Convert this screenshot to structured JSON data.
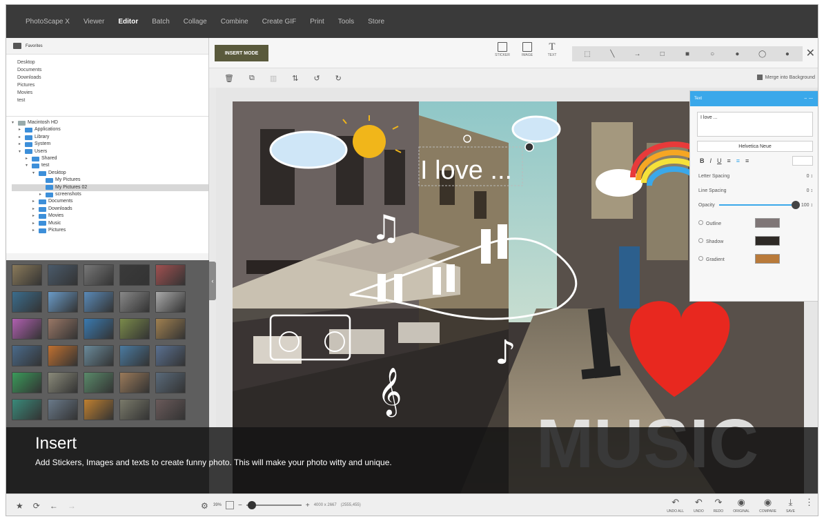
{
  "nav": {
    "items": [
      "PhotoScape X",
      "Viewer",
      "Editor",
      "Batch",
      "Collage",
      "Combine",
      "Create GIF",
      "Print",
      "Tools",
      "Store"
    ],
    "active": "Editor"
  },
  "sidebar": {
    "favorites_title": "Favorites",
    "favorites": [
      "Desktop",
      "Documents",
      "Downloads",
      "Pictures",
      "Movies",
      "test"
    ],
    "tree": [
      {
        "label": "Macintosh HD",
        "depth": 0,
        "type": "hd",
        "arrow": "▾"
      },
      {
        "label": "Applications",
        "depth": 1,
        "type": "folder",
        "arrow": "▸"
      },
      {
        "label": "Library",
        "depth": 1,
        "type": "folder",
        "arrow": "▸"
      },
      {
        "label": "System",
        "depth": 1,
        "type": "folder",
        "arrow": "▸"
      },
      {
        "label": "Users",
        "depth": 1,
        "type": "folder",
        "arrow": "▾"
      },
      {
        "label": "Shared",
        "depth": 2,
        "type": "folder",
        "arrow": "▸"
      },
      {
        "label": "test",
        "depth": 2,
        "type": "home",
        "arrow": "▾"
      },
      {
        "label": "Desktop",
        "depth": 3,
        "type": "folder",
        "arrow": "▾"
      },
      {
        "label": "My Pictures",
        "depth": 4,
        "type": "folder",
        "arrow": ""
      },
      {
        "label": "My Pictures 02",
        "depth": 4,
        "type": "folder",
        "arrow": "",
        "selected": true
      },
      {
        "label": "screenshots",
        "depth": 4,
        "type": "folder",
        "arrow": "▸"
      },
      {
        "label": "Documents",
        "depth": 3,
        "type": "folder",
        "arrow": "▸"
      },
      {
        "label": "Downloads",
        "depth": 3,
        "type": "folder",
        "arrow": "▸"
      },
      {
        "label": "Movies",
        "depth": 3,
        "type": "folder",
        "arrow": "▸"
      },
      {
        "label": "Music",
        "depth": 3,
        "type": "folder",
        "arrow": "▸"
      },
      {
        "label": "Pictures",
        "depth": 3,
        "type": "folder",
        "arrow": "▸"
      }
    ],
    "thumbnail_colors": [
      "#8a7a5a",
      "#4a5a6a",
      "#777",
      "#3a3a3a",
      "#a05050",
      "#3b6d8d",
      "#6a9bc8",
      "#5a8ab8",
      "#888",
      "#aaa",
      "#b060b0",
      "#997766",
      "#3a7ab0",
      "#7a8a4a",
      "#a08050",
      "#4a6a8a",
      "#c07030",
      "#6a8a9a",
      "#4a7aa0",
      "#5a7090",
      "#3a9a5a",
      "#8a8a7a",
      "#5a8a6a",
      "#9a7a5a",
      "#5a6a7a",
      "#3a8a7a",
      "#6a7a8a",
      "#c08030",
      "#7a7a6a",
      "#6a5a5a"
    ]
  },
  "toolbar": {
    "insert_mode": "INSERT MODE",
    "sticker": "STICKER",
    "image": "IMAGE",
    "text": "TEXT",
    "merge": "Merge into Background",
    "shapes": [
      "⬚",
      "╲",
      "→",
      "□",
      "■",
      "○",
      "●",
      "◯",
      "●"
    ],
    "close": "✕"
  },
  "photo": {
    "caption": "I love ...",
    "music": "MUSIC"
  },
  "text_panel": {
    "header": "Text",
    "header_icons": "⇔   —",
    "text_value": "I love ...",
    "font": "Helvetica Neue",
    "format": [
      "B",
      "I",
      "U",
      "≡",
      "≡",
      "≡"
    ],
    "letter_spacing": "Letter Spacing",
    "letter_spacing_value": "0 ↕",
    "line_spacing": "Line Spacing",
    "line_spacing_value": "0 ↕",
    "opacity": "Opacity",
    "opacity_value": "100 ↕",
    "outline": "Outline",
    "shadow": "Shadow",
    "gradient": "Gradient"
  },
  "overlay": {
    "title": "Insert",
    "description": "Add Stickers, Images and texts to create funny photo. This will make your photo witty and unique."
  },
  "bottom": {
    "zoom_percent": "39%",
    "dimensions": "4000 x 2667",
    "coords": "(2555,455)",
    "actions": [
      {
        "g": "↶",
        "l": "UNDO ALL"
      },
      {
        "g": "↶",
        "l": "UNDO"
      },
      {
        "g": "↷",
        "l": "REDO"
      },
      {
        "g": "◉",
        "l": "ORIGINAL"
      },
      {
        "g": "◉",
        "l": "COMPARE"
      },
      {
        "g": "⤓",
        "l": "SAVE"
      },
      {
        "g": "⋮",
        "l": ""
      }
    ]
  }
}
